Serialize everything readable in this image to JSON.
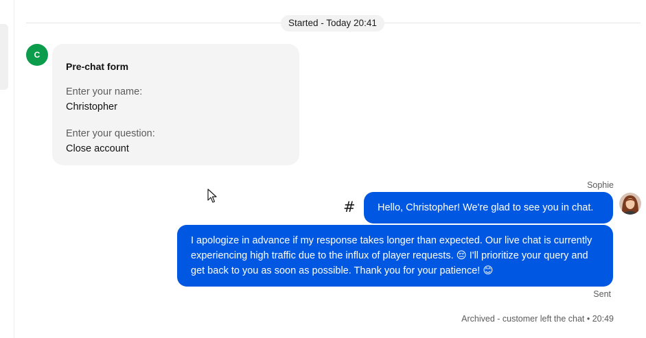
{
  "session_divider": {
    "label": "Started - Today 20:41"
  },
  "customer": {
    "avatar_initial": "C",
    "avatar_color": "#0b9d4c"
  },
  "prechat_form": {
    "title": "Pre-chat form",
    "fields": [
      {
        "label": "Enter your name:",
        "value": "Christopher"
      },
      {
        "label": "Enter your question:",
        "value": "Close account"
      }
    ]
  },
  "agent": {
    "name": "Sophie",
    "avatar_icon": "agent-photo-avatar"
  },
  "messages": [
    {
      "text": "Hello, Christopher! We're glad to see you in chat."
    },
    {
      "text": "I apologize in advance if my response takes longer than expected. Our live chat is currently experiencing high traffic due to the influx of player requests. 😔 I'll prioritize your query and get back to you as soon as possible. Thank you for your patience! 😊"
    }
  ],
  "hash_icon_glyph": "#",
  "message_status": "Sent",
  "archived_status": "Archived - customer left the chat • 20:49",
  "colors": {
    "agent_bubble": "#0057e1",
    "form_card": "#f4f4f4"
  }
}
